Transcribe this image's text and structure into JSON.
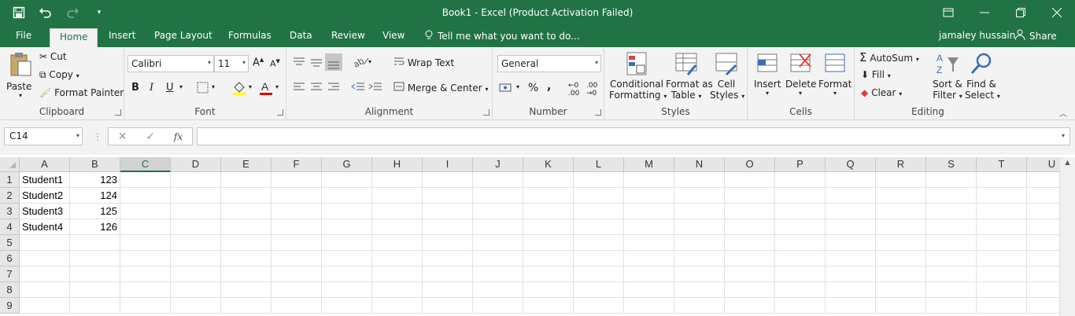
{
  "titlebar": {
    "title": "Book1 - Excel (Product Activation Failed)"
  },
  "tabs": [
    "File",
    "Home",
    "Insert",
    "Page Layout",
    "Formulas",
    "Data",
    "Review",
    "View"
  ],
  "tell_me": "Tell me what you want to do...",
  "user": "jamaley hussain",
  "share": "Share",
  "clipboard": {
    "paste": "Paste",
    "cut": "Cut",
    "copy": "Copy",
    "format_painter": "Format Painter",
    "label": "Clipboard"
  },
  "font": {
    "name": "Calibri",
    "size": "11",
    "bold": "B",
    "italic": "I",
    "underline": "U",
    "label": "Font"
  },
  "alignment": {
    "wrap": "Wrap Text",
    "merge": "Merge & Center",
    "label": "Alignment"
  },
  "number": {
    "format": "General",
    "percent": "%",
    "comma": ",",
    "label": "Number"
  },
  "styles": {
    "conditional": "Conditional",
    "conditional2": "Formatting",
    "format_as": "Format as",
    "format_as2": "Table",
    "cell": "Cell",
    "cell2": "Styles",
    "label": "Styles"
  },
  "cells": {
    "insert": "Insert",
    "delete": "Delete",
    "format": "Format",
    "label": "Cells"
  },
  "editing": {
    "autosum": "AutoSum",
    "fill": "Fill",
    "clear": "Clear",
    "sort": "Sort &",
    "sort2": "Filter",
    "find": "Find &",
    "find2": "Select",
    "label": "Editing"
  },
  "formula_bar": {
    "name_box": "C14",
    "fx": "fx",
    "value": ""
  },
  "columns": [
    "A",
    "B",
    "C",
    "D",
    "E",
    "F",
    "G",
    "H",
    "I",
    "J",
    "K",
    "L",
    "M",
    "N",
    "O",
    "P",
    "Q",
    "R",
    "S",
    "T",
    "U"
  ],
  "rows": [
    "1",
    "2",
    "3",
    "4",
    "5",
    "6",
    "7",
    "8",
    "9"
  ],
  "sheet_data": [
    {
      "a": "Student1",
      "b": "123"
    },
    {
      "a": "Student2",
      "b": "124"
    },
    {
      "a": "Student3",
      "b": "125"
    },
    {
      "a": "Student4",
      "b": "126"
    }
  ],
  "colors": {
    "accent": "#217346",
    "ribbon": "#f3f3f3"
  }
}
